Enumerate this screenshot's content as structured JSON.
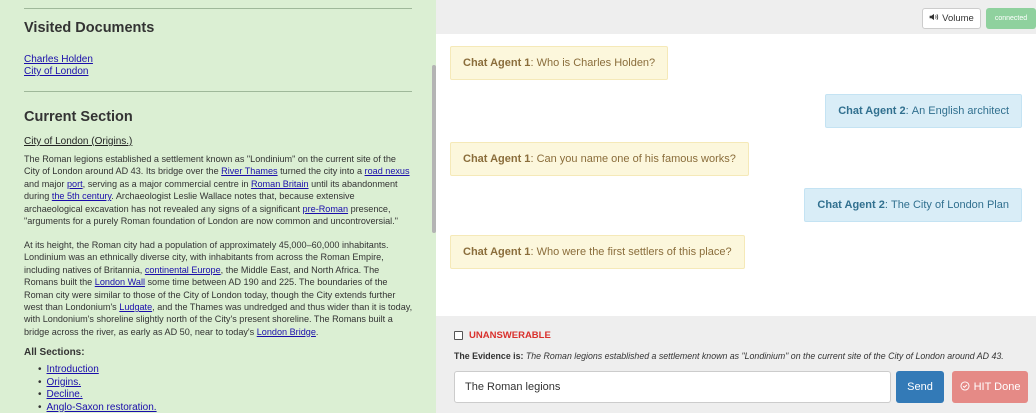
{
  "left": {
    "visited_heading": "Visited Documents",
    "visited_links": [
      "Charles Holden",
      "City of London"
    ],
    "current_heading": "Current Section",
    "section_title": "City of London (Origins.)",
    "para1": [
      {
        "t": "The Roman legions established a settlement known as \"Londinium\" on the current site of the City of London around AD 43. Its bridge over the "
      },
      {
        "l": "River Thames"
      },
      {
        "t": " turned the city into a "
      },
      {
        "l": "road nexus"
      },
      {
        "t": " and major "
      },
      {
        "l": "port"
      },
      {
        "t": ", serving as a major commercial centre in "
      },
      {
        "l": "Roman Britain"
      },
      {
        "t": " until its abandonment during "
      },
      {
        "l": "the 5th century"
      },
      {
        "t": ". Archaeologist Leslie Wallace notes that, because extensive archaeological excavation has not revealed any signs of a significant "
      },
      {
        "l": "pre-Roman"
      },
      {
        "t": " presence, \"arguments for a purely Roman foundation of London are now common and uncontroversial.\""
      }
    ],
    "para2": [
      {
        "t": "At its height, the Roman city had a population of approximately 45,000–60,000 inhabitants. Londinium was an ethnically diverse city, with inhabitants from across the Roman Empire, including natives of Britannia, "
      },
      {
        "l": "continental Europe"
      },
      {
        "t": ", the Middle East, and North Africa. The Romans built the "
      },
      {
        "l": "London Wall"
      },
      {
        "t": " some time between AD 190 and 225. The boundaries of the Roman city were similar to those of the City of London today, though the City extends further west than Londonium's "
      },
      {
        "l": "Ludgate"
      },
      {
        "t": ", and the Thames was undredged and thus wider than it is today, with Londonium's shoreline slightly north of the City's present shoreline. The Romans built a bridge across the river, as early as AD 50, near to today's "
      },
      {
        "l": "London Bridge"
      },
      {
        "t": "."
      }
    ],
    "all_sections_label": "All Sections:",
    "sections": [
      "Introduction",
      "Origins.",
      "Decline.",
      "Anglo-Saxon restoration."
    ]
  },
  "topbar": {
    "volume_label": "Volume",
    "volume_icon": "speaker-icon",
    "status": "connected",
    "status_color": "#8fd19e"
  },
  "chat": [
    {
      "speaker": "Chat Agent 1",
      "text": "Who is Charles Holden?",
      "side": "left"
    },
    {
      "speaker": "Chat Agent 2",
      "text": "An English architect",
      "side": "right"
    },
    {
      "speaker": "Chat Agent 1",
      "text": "Can you name one of his famous works?",
      "side": "left"
    },
    {
      "speaker": "Chat Agent 2",
      "text": "The City of London Plan",
      "side": "right"
    },
    {
      "speaker": "Chat Agent 1",
      "text": "Who were the first settlers of this place?",
      "side": "left"
    }
  ],
  "bottom": {
    "unanswerable_label": "UNANSWERABLE",
    "evidence_label": "The Evidence is:",
    "evidence_text": "The Roman legions established a settlement known as \"Londinium\" on the current site of the City of London around AD 43.",
    "answer_value": "The Roman legions",
    "send_label": "Send",
    "hit_done_label": "HIT Done",
    "hit_done_icon": "circle-check-icon",
    "send_color": "#337ab7",
    "hit_done_color": "#e58a86",
    "unanswerable_color": "#d9302c"
  }
}
